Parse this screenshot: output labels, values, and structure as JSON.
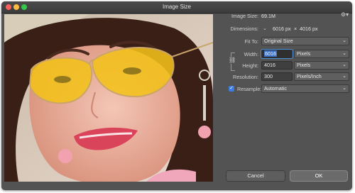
{
  "window": {
    "title": "Image Size"
  },
  "info": {
    "image_size_label": "Image Size:",
    "image_size_value": "69.1M",
    "dimensions_label": "Dimensions:",
    "dimensions_width": "6016 px",
    "dimensions_sep": "×",
    "dimensions_height": "4016 px"
  },
  "fit_to": {
    "label": "Fit To:",
    "value": "Original Size"
  },
  "width": {
    "label": "Width:",
    "value": "6016",
    "unit": "Pixels"
  },
  "height": {
    "label": "Height:",
    "value": "4016",
    "unit": "Pixels"
  },
  "resolution": {
    "label": "Resolution:",
    "value": "300",
    "unit": "Pixels/Inch"
  },
  "resample": {
    "label": "Resample:",
    "checked": true,
    "value": "Automatic"
  },
  "buttons": {
    "cancel": "Cancel",
    "ok": "OK"
  },
  "colors": {
    "dialog_bg": "#535353",
    "accent": "#3b7de0",
    "lens": "#f2c21a"
  }
}
